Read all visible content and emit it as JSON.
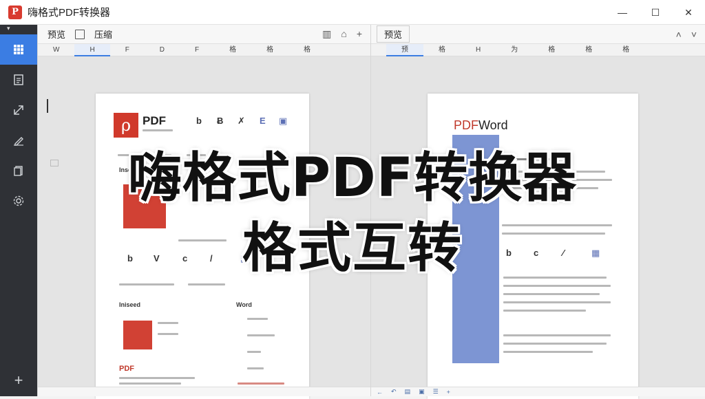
{
  "window": {
    "title": "嗨格式PDF转换器",
    "logo_glyph": "P"
  },
  "window_controls": {
    "minimize": "—",
    "maximize": "☐",
    "close": "✕"
  },
  "sidebar": {
    "items": [
      "grid-icon",
      "document-icon",
      "export-icon",
      "edit-icon",
      "files-icon",
      "settings-icon"
    ],
    "active_index": 0,
    "add_label": "+"
  },
  "left_pane": {
    "toolbar": {
      "label1": "预览",
      "label2": "压缩"
    },
    "tabs": [
      "W",
      "H",
      "F",
      "D",
      "F",
      "格",
      "格",
      "格"
    ],
    "page": {
      "pdf_label": "PDF",
      "section_label": "Insert",
      "bottom_label": "PDF",
      "word_label": "Word"
    }
  },
  "right_pane": {
    "toolbar": {
      "label1": "预览"
    },
    "tabs": [
      "预",
      "格",
      "H",
      "为",
      "格",
      "格",
      "格"
    ],
    "page": {
      "title_pdf": "PDF",
      "title_word": "Word"
    }
  },
  "overlay": {
    "line1": "嗨格式PDF转换器",
    "line2": "格式互转"
  },
  "colors": {
    "accent": "#3b7de3",
    "brand_red": "#d0392b",
    "sidebar_bg": "#2f3136"
  }
}
